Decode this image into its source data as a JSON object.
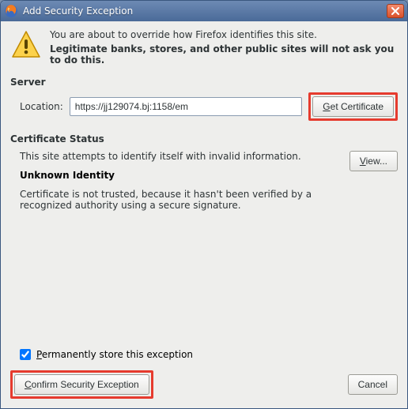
{
  "window": {
    "title": "Add Security Exception"
  },
  "warning": {
    "line1": "You are about to override how Firefox identifies this site.",
    "line2": "Legitimate banks, stores, and other public sites will not ask you to do this."
  },
  "server": {
    "heading": "Server",
    "location_label": "Location:",
    "location_value": "https://jj129074.bj:1158/em",
    "get_cert_label": "Get Certificate"
  },
  "cert_status": {
    "heading": "Certificate Status",
    "attempt_text": "This site attempts to identify itself with invalid information.",
    "view_label": "View...",
    "unknown_heading": "Unknown Identity",
    "unknown_text": "Certificate is not trusted, because it hasn't been verified by a recognized authority using a secure signature."
  },
  "checkbox": {
    "checked": true,
    "label_pre": "P",
    "label_rest": "ermanently store this exception"
  },
  "buttons": {
    "confirm": "Confirm Security Exception",
    "cancel": "Cancel"
  }
}
